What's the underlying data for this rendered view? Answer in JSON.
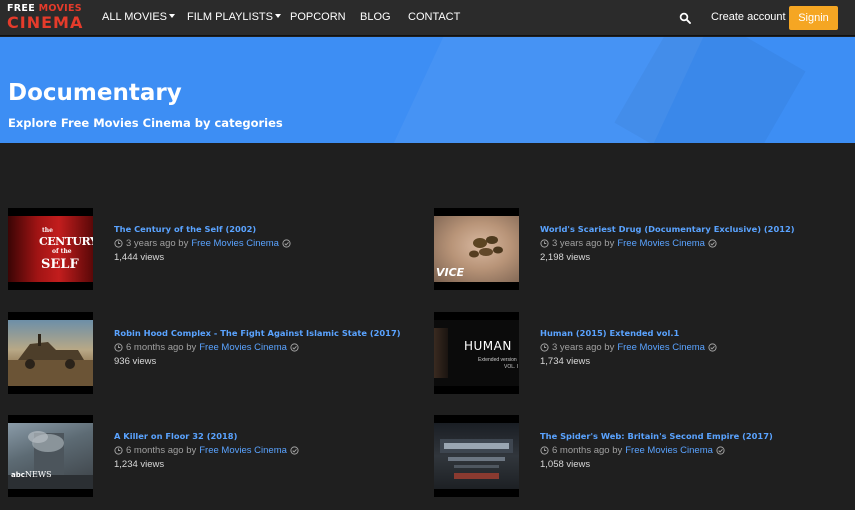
{
  "logo": {
    "line1_a": "FREE",
    "line1_b": "MOVIES",
    "line2": "CINEMA"
  },
  "nav": {
    "items": [
      {
        "label": "ALL MOVIES",
        "dropdown": true
      },
      {
        "label": "FILM PLAYLISTS",
        "dropdown": true
      },
      {
        "label": "POPCORN",
        "dropdown": false
      },
      {
        "label": "BLOG",
        "dropdown": false
      },
      {
        "label": "CONTACT",
        "dropdown": false
      }
    ],
    "search_icon": "search-icon",
    "create_account": "Create account",
    "signin": "Signin"
  },
  "banner": {
    "title": "Documentary",
    "subtitle": "Explore Free Movies Cinema by categories"
  },
  "colors": {
    "banner": "#3d8ef4",
    "accent_link": "#5aa3ff",
    "signin": "#f5a623",
    "logo_red": "#e53b2b"
  },
  "videos": [
    {
      "title": "The Century of the Self (2002)",
      "age": "3 years ago by",
      "channel": "Free Movies Cinema",
      "views": "1,444 views",
      "thumb_text": [
        "the",
        "CENTURY",
        "of the",
        "SELF"
      ]
    },
    {
      "title": "World's Scariest Drug (Documentary Exclusive) (2012)",
      "age": "3 years ago by",
      "channel": "Free Movies Cinema",
      "views": "2,198 views",
      "thumb_text": [
        "VICE"
      ]
    },
    {
      "title": "Robin Hood Complex - The Fight Against Islamic State (2017)",
      "age": "6 months ago by",
      "channel": "Free Movies Cinema",
      "views": "936 views",
      "thumb_text": []
    },
    {
      "title": "Human (2015) Extended vol.1",
      "age": "3 years ago by",
      "channel": "Free Movies Cinema",
      "views": "1,734 views",
      "thumb_text": [
        "HUMAN",
        "Extended version",
        "VOL. I"
      ]
    },
    {
      "title": "A Killer on Floor 32 (2018)",
      "age": "6 months ago by",
      "channel": "Free Movies Cinema",
      "views": "1,234 views",
      "thumb_text": [
        "abc",
        "NEWS"
      ]
    },
    {
      "title": "The Spider's Web: Britain's Second Empire (2017)",
      "age": "6 months ago by",
      "channel": "Free Movies Cinema",
      "views": "1,058 views",
      "thumb_text": []
    }
  ]
}
